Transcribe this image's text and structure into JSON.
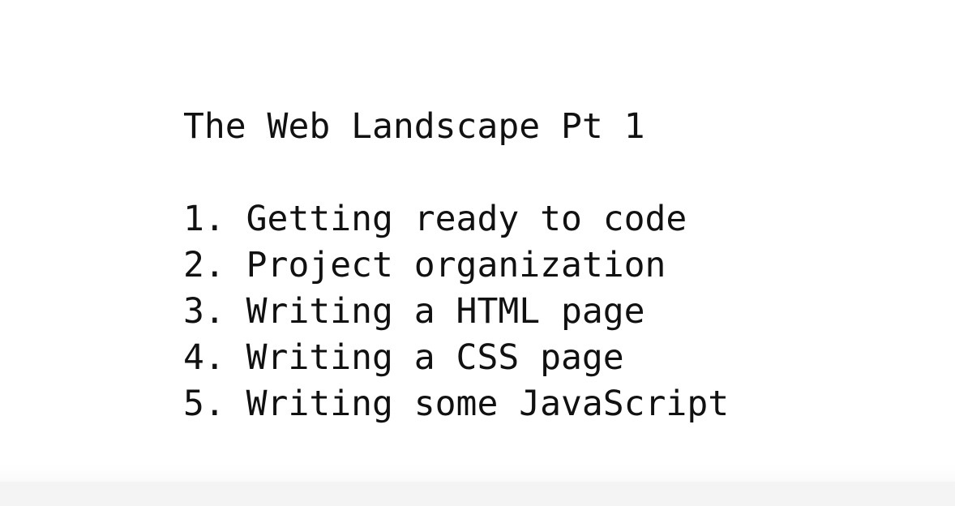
{
  "slide": {
    "title": "The Web Landscape Pt 1",
    "items": [
      {
        "number": "1.",
        "text": "Getting ready to code"
      },
      {
        "number": "2.",
        "text": "Project organization"
      },
      {
        "number": "3.",
        "text": "Writing a HTML page"
      },
      {
        "number": "4.",
        "text": "Writing a CSS page"
      },
      {
        "number": "5.",
        "text": "Writing some JavaScript"
      }
    ]
  }
}
